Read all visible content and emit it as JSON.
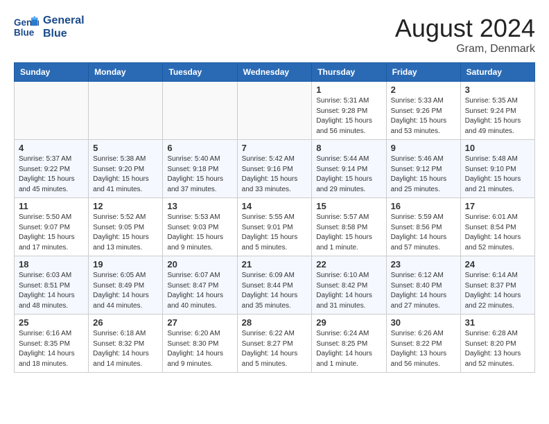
{
  "header": {
    "logo_line1": "General",
    "logo_line2": "Blue",
    "month_title": "August 2024",
    "location": "Gram, Denmark"
  },
  "weekdays": [
    "Sunday",
    "Monday",
    "Tuesday",
    "Wednesday",
    "Thursday",
    "Friday",
    "Saturday"
  ],
  "weeks": [
    [
      {
        "day": "",
        "info": ""
      },
      {
        "day": "",
        "info": ""
      },
      {
        "day": "",
        "info": ""
      },
      {
        "day": "",
        "info": ""
      },
      {
        "day": "1",
        "info": "Sunrise: 5:31 AM\nSunset: 9:28 PM\nDaylight: 15 hours\nand 56 minutes."
      },
      {
        "day": "2",
        "info": "Sunrise: 5:33 AM\nSunset: 9:26 PM\nDaylight: 15 hours\nand 53 minutes."
      },
      {
        "day": "3",
        "info": "Sunrise: 5:35 AM\nSunset: 9:24 PM\nDaylight: 15 hours\nand 49 minutes."
      }
    ],
    [
      {
        "day": "4",
        "info": "Sunrise: 5:37 AM\nSunset: 9:22 PM\nDaylight: 15 hours\nand 45 minutes."
      },
      {
        "day": "5",
        "info": "Sunrise: 5:38 AM\nSunset: 9:20 PM\nDaylight: 15 hours\nand 41 minutes."
      },
      {
        "day": "6",
        "info": "Sunrise: 5:40 AM\nSunset: 9:18 PM\nDaylight: 15 hours\nand 37 minutes."
      },
      {
        "day": "7",
        "info": "Sunrise: 5:42 AM\nSunset: 9:16 PM\nDaylight: 15 hours\nand 33 minutes."
      },
      {
        "day": "8",
        "info": "Sunrise: 5:44 AM\nSunset: 9:14 PM\nDaylight: 15 hours\nand 29 minutes."
      },
      {
        "day": "9",
        "info": "Sunrise: 5:46 AM\nSunset: 9:12 PM\nDaylight: 15 hours\nand 25 minutes."
      },
      {
        "day": "10",
        "info": "Sunrise: 5:48 AM\nSunset: 9:10 PM\nDaylight: 15 hours\nand 21 minutes."
      }
    ],
    [
      {
        "day": "11",
        "info": "Sunrise: 5:50 AM\nSunset: 9:07 PM\nDaylight: 15 hours\nand 17 minutes."
      },
      {
        "day": "12",
        "info": "Sunrise: 5:52 AM\nSunset: 9:05 PM\nDaylight: 15 hours\nand 13 minutes."
      },
      {
        "day": "13",
        "info": "Sunrise: 5:53 AM\nSunset: 9:03 PM\nDaylight: 15 hours\nand 9 minutes."
      },
      {
        "day": "14",
        "info": "Sunrise: 5:55 AM\nSunset: 9:01 PM\nDaylight: 15 hours\nand 5 minutes."
      },
      {
        "day": "15",
        "info": "Sunrise: 5:57 AM\nSunset: 8:58 PM\nDaylight: 15 hours\nand 1 minute."
      },
      {
        "day": "16",
        "info": "Sunrise: 5:59 AM\nSunset: 8:56 PM\nDaylight: 14 hours\nand 57 minutes."
      },
      {
        "day": "17",
        "info": "Sunrise: 6:01 AM\nSunset: 8:54 PM\nDaylight: 14 hours\nand 52 minutes."
      }
    ],
    [
      {
        "day": "18",
        "info": "Sunrise: 6:03 AM\nSunset: 8:51 PM\nDaylight: 14 hours\nand 48 minutes."
      },
      {
        "day": "19",
        "info": "Sunrise: 6:05 AM\nSunset: 8:49 PM\nDaylight: 14 hours\nand 44 minutes."
      },
      {
        "day": "20",
        "info": "Sunrise: 6:07 AM\nSunset: 8:47 PM\nDaylight: 14 hours\nand 40 minutes."
      },
      {
        "day": "21",
        "info": "Sunrise: 6:09 AM\nSunset: 8:44 PM\nDaylight: 14 hours\nand 35 minutes."
      },
      {
        "day": "22",
        "info": "Sunrise: 6:10 AM\nSunset: 8:42 PM\nDaylight: 14 hours\nand 31 minutes."
      },
      {
        "day": "23",
        "info": "Sunrise: 6:12 AM\nSunset: 8:40 PM\nDaylight: 14 hours\nand 27 minutes."
      },
      {
        "day": "24",
        "info": "Sunrise: 6:14 AM\nSunset: 8:37 PM\nDaylight: 14 hours\nand 22 minutes."
      }
    ],
    [
      {
        "day": "25",
        "info": "Sunrise: 6:16 AM\nSunset: 8:35 PM\nDaylight: 14 hours\nand 18 minutes."
      },
      {
        "day": "26",
        "info": "Sunrise: 6:18 AM\nSunset: 8:32 PM\nDaylight: 14 hours\nand 14 minutes."
      },
      {
        "day": "27",
        "info": "Sunrise: 6:20 AM\nSunset: 8:30 PM\nDaylight: 14 hours\nand 9 minutes."
      },
      {
        "day": "28",
        "info": "Sunrise: 6:22 AM\nSunset: 8:27 PM\nDaylight: 14 hours\nand 5 minutes."
      },
      {
        "day": "29",
        "info": "Sunrise: 6:24 AM\nSunset: 8:25 PM\nDaylight: 14 hours\nand 1 minute."
      },
      {
        "day": "30",
        "info": "Sunrise: 6:26 AM\nSunset: 8:22 PM\nDaylight: 13 hours\nand 56 minutes."
      },
      {
        "day": "31",
        "info": "Sunrise: 6:28 AM\nSunset: 8:20 PM\nDaylight: 13 hours\nand 52 minutes."
      }
    ]
  ]
}
